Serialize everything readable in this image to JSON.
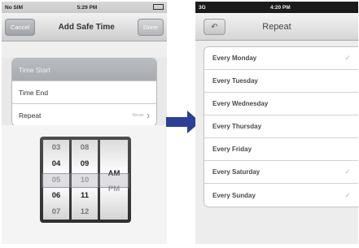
{
  "left": {
    "status": {
      "carrier": "No SIM",
      "time": "5:29 PM"
    },
    "nav": {
      "cancel": "Cancel",
      "title": "Add Safe Time",
      "done": "Done"
    },
    "rows": [
      {
        "label": "Time Start",
        "detail": ""
      },
      {
        "label": "Time End",
        "detail": ""
      },
      {
        "label": "Repeat",
        "detail": "Never"
      }
    ],
    "picker": {
      "hours": [
        "03",
        "04",
        "05",
        "06",
        "07"
      ],
      "minutes": [
        "08",
        "09",
        "10",
        "11",
        "12"
      ],
      "periods": [
        "AM",
        "PM"
      ]
    }
  },
  "right": {
    "status": {
      "carrier": "3G",
      "time": "4:20 PM"
    },
    "title": "Repeat",
    "back_icon": "back-arrow",
    "days": [
      {
        "label": "Every Monday",
        "checked": true
      },
      {
        "label": "Every Tuesday",
        "checked": false
      },
      {
        "label": "Every Wednesday",
        "checked": false
      },
      {
        "label": "Every Thursday",
        "checked": false
      },
      {
        "label": "Every Friday",
        "checked": false
      },
      {
        "label": "Every Saturday",
        "checked": true
      },
      {
        "label": "Every Sunday",
        "checked": true
      }
    ],
    "check_glyph": "✓"
  },
  "colors": {
    "arrow": "#2b3f9a",
    "selected_row": "#adb0b5"
  }
}
